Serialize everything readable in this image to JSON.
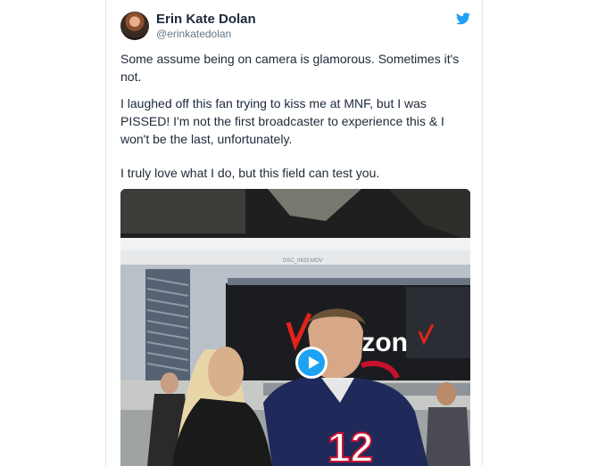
{
  "tweet": {
    "author_name": "Erin Kate Dolan",
    "author_handle": "@erinkatedolan",
    "paragraphs": [
      "Some assume being on camera is glamorous. Sometimes it's not.",
      "I laughed off this fan trying to kiss me at MNF, but I was PISSED! I'm not the first broadcaster to experience this & I won't be the last, unfortunately.",
      "I truly love what I do, but this field can test you."
    ]
  },
  "media": {
    "overlay_filename": "DSC_0633.MOV",
    "sign_text": "izon",
    "jersey_number": "12"
  },
  "colors": {
    "twitter_blue": "#1da1f2",
    "text": "#1c2938",
    "muted": "#657786"
  }
}
